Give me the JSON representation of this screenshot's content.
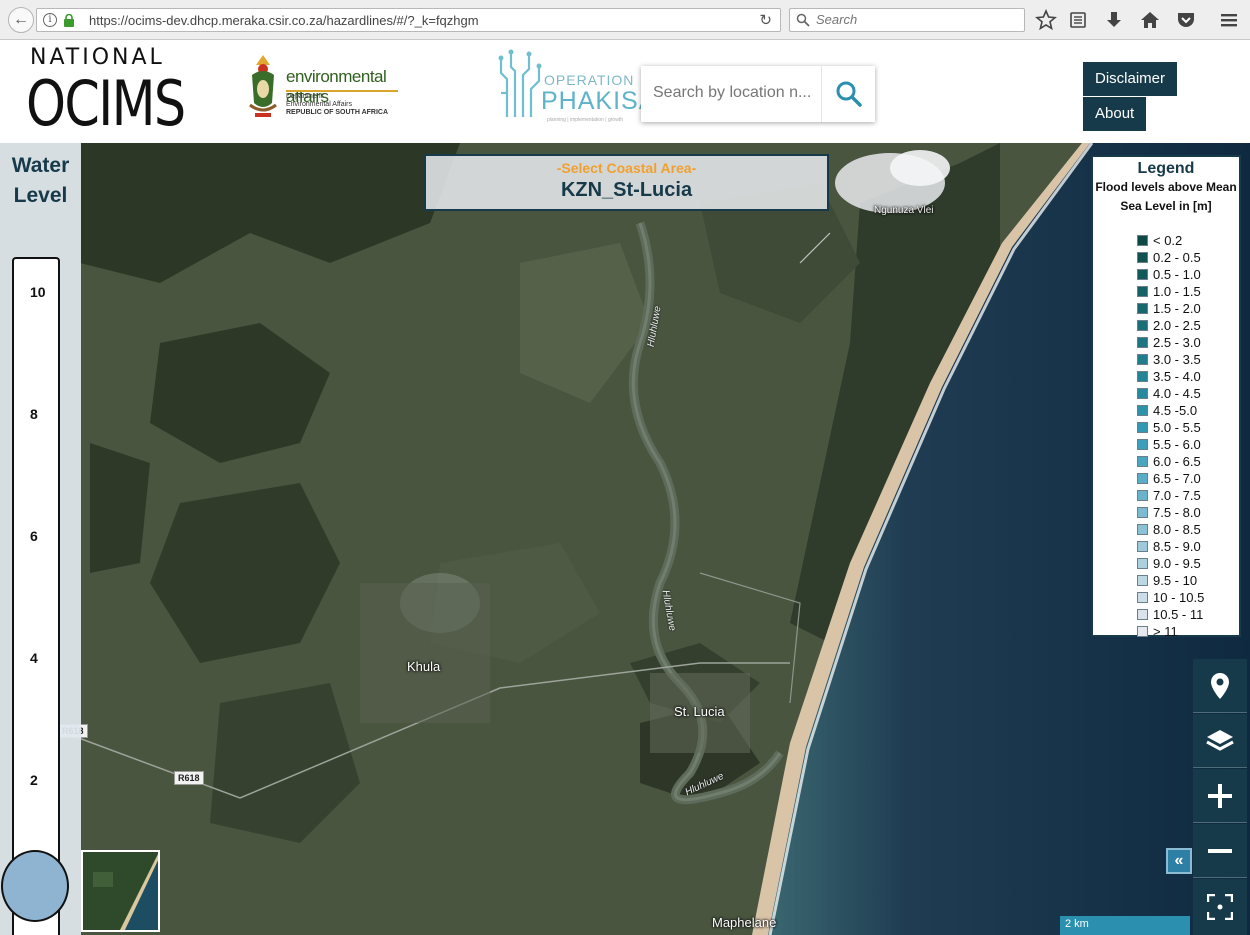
{
  "browser": {
    "url": "https://ocims-dev.dhcp.meraka.csir.co.za/hazardlines/#/?_k=fqzhgm",
    "search_placeholder": "Search"
  },
  "header": {
    "logo_ocims_top": "NATIONAL",
    "logo_ocims_main": "OCIMS",
    "logo_env_title": "environmental affairs",
    "logo_env_sub1": "Department:",
    "logo_env_sub2": "Environmental Affairs",
    "logo_env_sub3": "REPUBLIC OF SOUTH AFRICA",
    "logo_phakisa_top": "OPERATION",
    "logo_phakisa_main": "PHAKISA",
    "logo_phakisa_tag": "planning | implementation | growth",
    "location_placeholder": "Search by location n...",
    "disclaimer_label": "Disclaimer",
    "about_label": "About"
  },
  "water_level": {
    "title_line1": "Water",
    "title_line2": "Level",
    "ticks": [
      "10",
      "8",
      "6",
      "4",
      "2"
    ]
  },
  "coastal_area": {
    "prompt": "-Select Coastal Area-",
    "value": "KZN_St-Lucia"
  },
  "legend": {
    "title": "Legend",
    "subtitle_line1": "Flood levels above Mean",
    "subtitle_line2": "Sea Level in [m]",
    "items": [
      {
        "label": "< 0.2",
        "color": "#0e4a45"
      },
      {
        "label": "0.2 - 0.5",
        "color": "#10524f"
      },
      {
        "label": "0.5 - 1.0",
        "color": "#125a59"
      },
      {
        "label": "1.0 - 1.5",
        "color": "#156163"
      },
      {
        "label": "1.5 - 2.0",
        "color": "#17686d"
      },
      {
        "label": "2.0 - 2.5",
        "color": "#1a6f78"
      },
      {
        "label": "2.5 - 3.0",
        "color": "#1d7682"
      },
      {
        "label": "3.0 - 3.5",
        "color": "#207d8c"
      },
      {
        "label": "3.5 - 4.0",
        "color": "#238496"
      },
      {
        "label": "4.0 - 4.5",
        "color": "#278ba0"
      },
      {
        "label": "4.5 -5.0",
        "color": "#2c92aa"
      },
      {
        "label": "5.0 - 5.5",
        "color": "#3399b3"
      },
      {
        "label": "5.5 - 6.0",
        "color": "#3d9fba"
      },
      {
        "label": "6.0 - 6.5",
        "color": "#4aa6c0"
      },
      {
        "label": "6.5 - 7.0",
        "color": "#5aadc6"
      },
      {
        "label": "7.0 - 7.5",
        "color": "#6ab4cb"
      },
      {
        "label": "7.5 - 8.0",
        "color": "#7bbbd0"
      },
      {
        "label": "8.0 - 8.5",
        "color": "#8cc2d5"
      },
      {
        "label": "8.5 - 9.0",
        "color": "#9dc9da"
      },
      {
        "label": "9.0 - 9.5",
        "color": "#add0df"
      },
      {
        "label": "9.5 - 10",
        "color": "#bdd7e4"
      },
      {
        "label": "10 - 10.5",
        "color": "#cbdde8"
      },
      {
        "label": "10.5 - 11",
        "color": "#d8e3ec"
      },
      {
        "label": "> 11",
        "color": "#e5e9f0"
      }
    ]
  },
  "map": {
    "place_labels": [
      "Khula",
      "St. Lucia",
      "Maphelane",
      "Ngunuza Vlei"
    ],
    "river_label": "Hluhluwe",
    "road_label": "R618",
    "scale_label": "2 km",
    "collapse_label": "«"
  },
  "colors": {
    "primary": "#173a4a",
    "accent": "#f0a030",
    "scale_bar": "#2b8fb0"
  }
}
